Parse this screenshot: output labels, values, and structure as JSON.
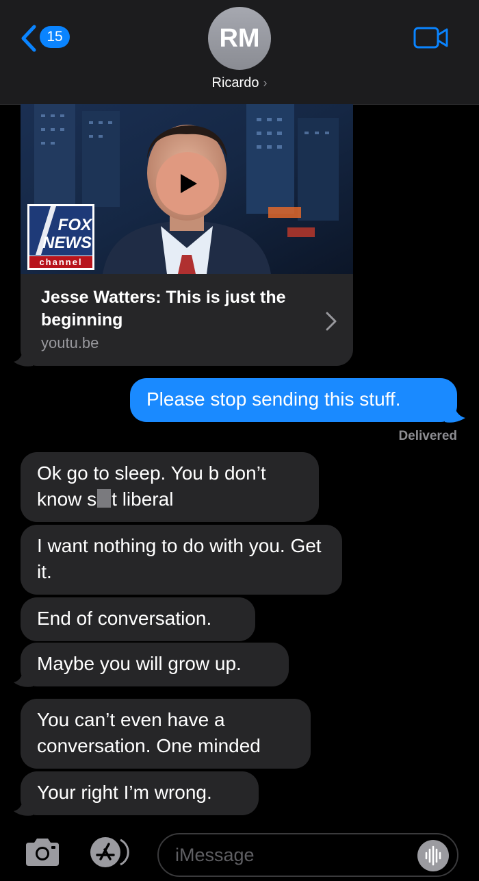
{
  "header": {
    "unread_count": "15",
    "avatar_initials": "RM",
    "contact_name": "Ricardo"
  },
  "link_card": {
    "title": "Jesse Watters: This is just the beginning",
    "domain": "youtu.be",
    "logo_line1": "FOX",
    "logo_line2": "NEWS",
    "logo_line3": "channel"
  },
  "messages": [
    {
      "side": "out",
      "text": "Please stop sending this stuff."
    },
    {
      "side": "in",
      "text_before": "Ok go to sleep. You b don’t know s",
      "text_after": "t liberal"
    },
    {
      "side": "in",
      "text": "I want nothing to do with you. Get it."
    },
    {
      "side": "in",
      "text": "End of conversation."
    },
    {
      "side": "in",
      "text": "Maybe you will grow up."
    },
    {
      "side": "in",
      "text": "You can’t even have a conversation. One minded"
    },
    {
      "side": "in",
      "text": "Your right I’m wrong."
    }
  ],
  "delivered_label": "Delivered",
  "input": {
    "placeholder": "iMessage"
  },
  "colors": {
    "outgoing_bubble": "#1a8aff",
    "incoming_bubble": "#262628",
    "accent": "#0a84ff",
    "background": "#000000"
  },
  "icons": [
    "back-chevron-icon",
    "facetime-video-icon",
    "play-icon",
    "chevron-right-icon",
    "camera-icon",
    "app-store-icon",
    "audio-waveform-icon"
  ]
}
